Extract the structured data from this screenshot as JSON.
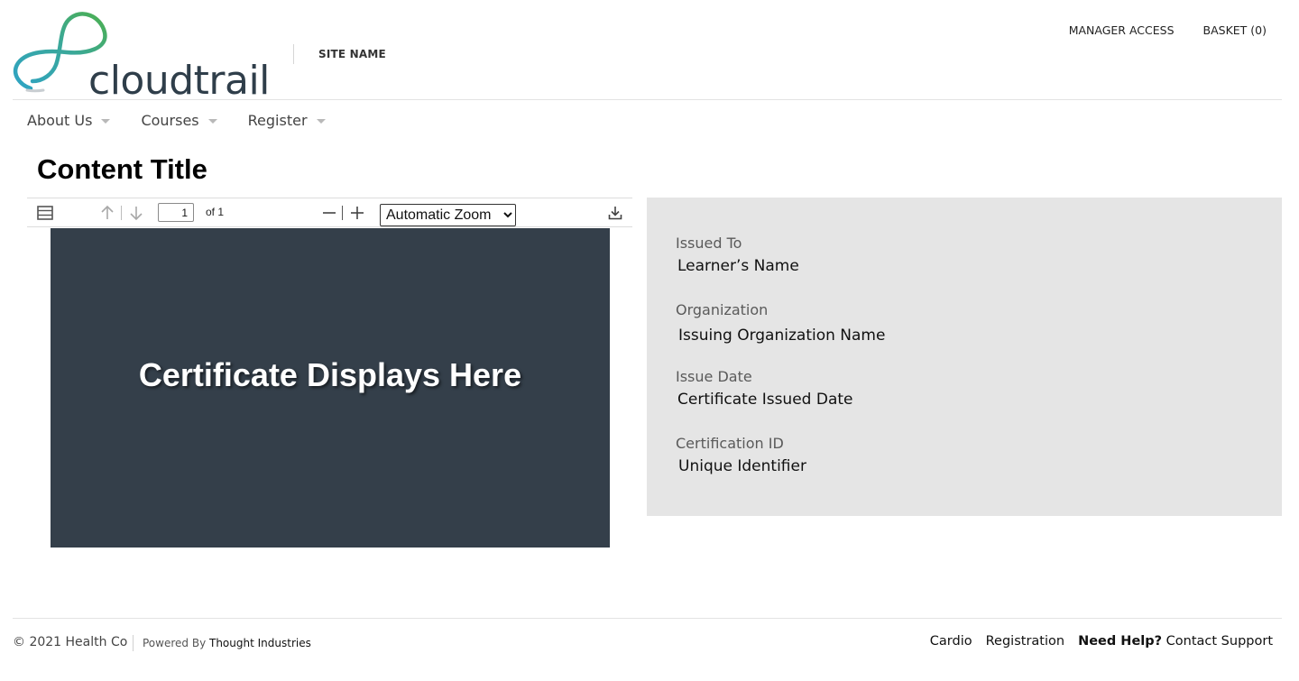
{
  "header": {
    "logo_text": "cloudtrail",
    "site_name": "SITE NAME",
    "manager_access": "MANAGER ACCESS",
    "basket": "BASKET (0)"
  },
  "nav": [
    {
      "label": "About Us"
    },
    {
      "label": "Courses"
    },
    {
      "label": "Register"
    }
  ],
  "page_title": "Content Title",
  "viewer": {
    "page_number": "1",
    "page_count": "of 1",
    "zoom": {
      "selected": "Automatic Zoom"
    },
    "certificate_text": "Certificate Displays Here",
    "page_color": "#343f4a"
  },
  "details": {
    "issued_to_label": "Issued To",
    "issued_to_value": "Learner’s Name",
    "organization_label": "Organization",
    "organization_value": "Issuing Organization Name",
    "issue_date_label": "Issue Date",
    "issue_date_value": "Certificate Issued Date",
    "cert_id_label": "Certification ID",
    "cert_id_value": "Unique Identifier",
    "background": "#e5e5e5"
  },
  "footer": {
    "copyright": "© 2021 Health Co",
    "powered_by": "Powered By",
    "powered_brand": "Thought Industries",
    "links": [
      "Cardio",
      "Registration"
    ],
    "help_bold": "Need Help?",
    "help_link": "Contact Support"
  },
  "colors": {
    "logo_green": "#4caf50",
    "logo_teal": "#2fa3c4",
    "logo_text": "#2f3e4a"
  }
}
